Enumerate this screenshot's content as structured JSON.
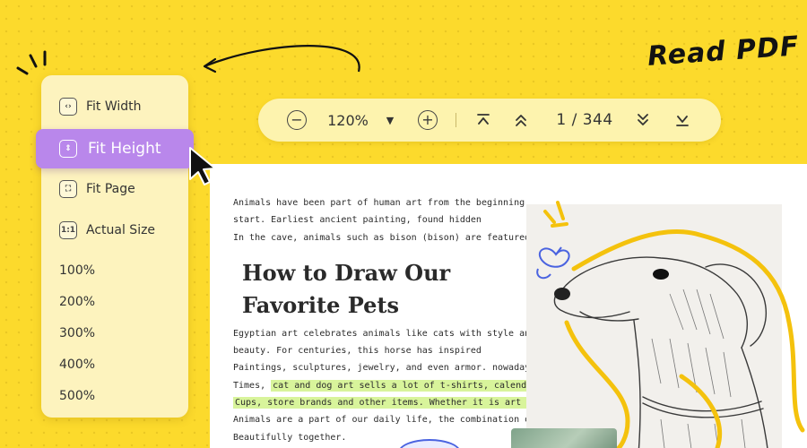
{
  "headline": "Read PDF",
  "toolbar": {
    "zoom_out_symbol": "−",
    "zoom_value": "120%",
    "dropdown_caret": "▼",
    "zoom_in_symbol": "+",
    "first_page_symbol": "⌅",
    "prev_page_symbol": "⌃",
    "page_indicator": "1 / 344",
    "next_page_symbol": "⌄",
    "last_page_symbol": "⌄"
  },
  "menu": {
    "items": [
      {
        "label": "Fit Width",
        "icon": "fit-width-icon",
        "icon_glyph": "‹›"
      },
      {
        "label": "Fit Height",
        "icon": "fit-height-icon",
        "icon_glyph": "⇕",
        "active": true
      },
      {
        "label": "Fit Page",
        "icon": "fit-page-icon",
        "icon_glyph": "⛶"
      },
      {
        "label": "Actual Size",
        "icon": "actual-size-icon",
        "icon_glyph": "1:1"
      }
    ],
    "zoom_levels": [
      "100%",
      "200%",
      "300%",
      "400%",
      "500%"
    ]
  },
  "document": {
    "intro_lines": [
      "Animals have been part of human art from the beginning",
      "start. Earliest ancient painting, found hidden",
      "In the cave, animals such as bison (bison) are featured."
    ],
    "heading_lines": [
      "How to Draw Our",
      "Favorite Pets"
    ],
    "para_line_1": "Egyptian art celebrates animals like cats with style and style",
    "para_line_2": "beauty. For centuries, this horse has inspired",
    "para_line_3": "Paintings, sculptures, jewelry, and even armor. nowadays",
    "para_line_4_plain": "Times, ",
    "para_line_4_highlight": "cat and dog art sells a lot of t-shirts, calendars, coffee",
    "para_line_5_highlight": "Cups, store brands and other items. Whether it is art or domestic",
    "para_line_6": "Animals are a part of our daily life, the combination of the two",
    "para_line_7": "Beautifully together."
  },
  "colors": {
    "background": "#FCDA2C",
    "menu_background": "#FDF3BE",
    "active_item": "#B987EB",
    "highlight": "#D8F49B",
    "squiggle": "#F4C20D",
    "butterfly": "#4A63E0"
  }
}
